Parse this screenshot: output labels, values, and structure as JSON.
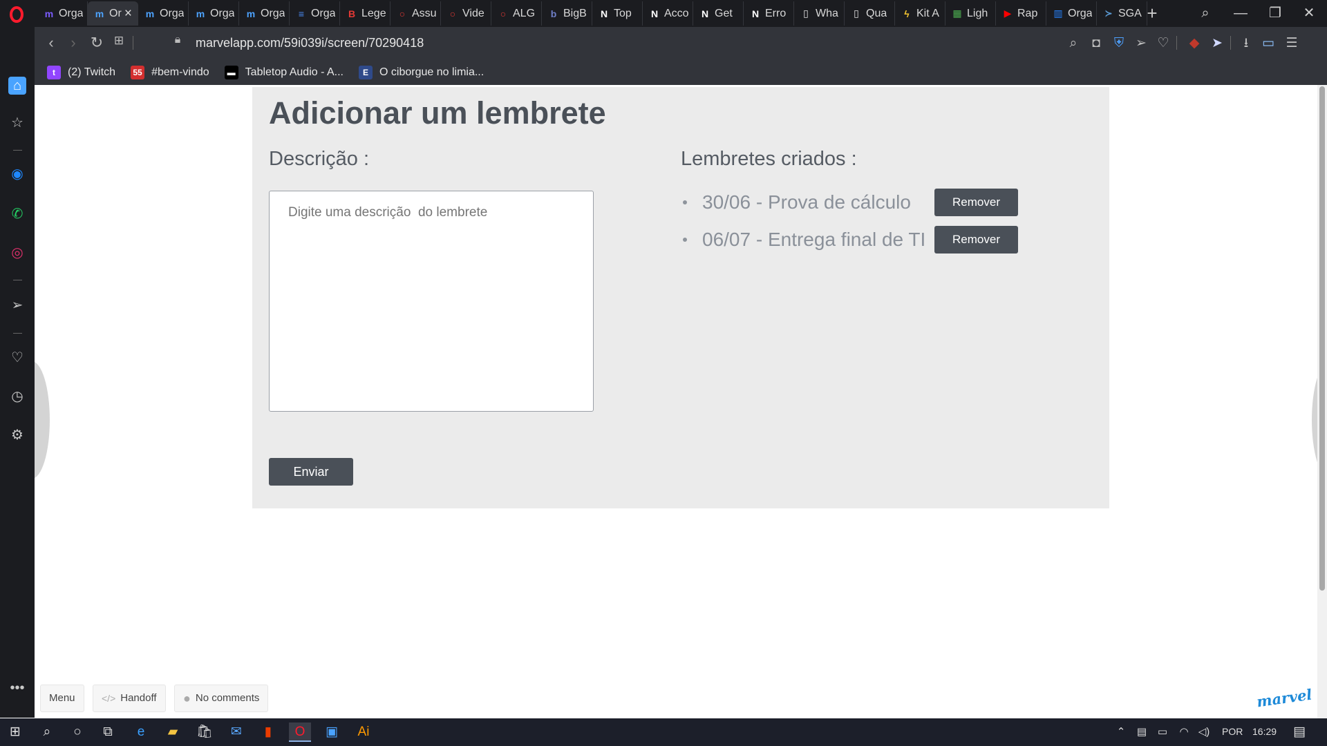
{
  "browser": {
    "tabs": [
      {
        "label": "Orga",
        "icon": "marvel-icon",
        "color": "#7b5cff",
        "glyph": "m"
      },
      {
        "label": "Or",
        "icon": "marvel-icon",
        "color": "#4da3ff",
        "glyph": "m",
        "active": true
      },
      {
        "label": "Orga",
        "icon": "marvel-icon",
        "color": "#4da3ff",
        "glyph": "m"
      },
      {
        "label": "Orga",
        "icon": "marvel-icon",
        "color": "#4da3ff",
        "glyph": "m"
      },
      {
        "label": "Orga",
        "icon": "marvel-icon",
        "color": "#4da3ff",
        "glyph": "m"
      },
      {
        "label": "Orga",
        "icon": "docs-icon",
        "color": "#4a8af4",
        "glyph": "≡"
      },
      {
        "label": "Lege",
        "icon": "b-icon",
        "color": "#e53935",
        "glyph": "B"
      },
      {
        "label": "Assu",
        "icon": "opera-ring-icon",
        "color": "#e53935",
        "glyph": "○"
      },
      {
        "label": "Vide",
        "icon": "opera-ring-icon",
        "color": "#e53935",
        "glyph": "○"
      },
      {
        "label": "ALG",
        "icon": "opera-ring-icon",
        "color": "#e53935",
        "glyph": "○"
      },
      {
        "label": "BigB",
        "icon": "bigbrain-icon",
        "color": "#6f7fc8",
        "glyph": "b"
      },
      {
        "label": "Top",
        "icon": "notion-icon",
        "color": "#ffffff",
        "glyph": "N"
      },
      {
        "label": "Acco",
        "icon": "notion-icon",
        "color": "#ffffff",
        "glyph": "N"
      },
      {
        "label": "Get",
        "icon": "notion-icon",
        "color": "#ffffff",
        "glyph": "N"
      },
      {
        "label": "Erro",
        "icon": "notion-icon",
        "color": "#ffffff",
        "glyph": "N"
      },
      {
        "label": "Wha",
        "icon": "document-icon",
        "color": "#e0e0e0",
        "glyph": "▯"
      },
      {
        "label": "Qua",
        "icon": "document-icon",
        "color": "#e0e0e0",
        "glyph": "▯"
      },
      {
        "label": "Kit A",
        "icon": "bolt-icon",
        "color": "#f4c430",
        "glyph": "ϟ"
      },
      {
        "label": "Ligh",
        "icon": "grid-icon",
        "color": "#4caf50",
        "glyph": "▦"
      },
      {
        "label": "Rap",
        "icon": "youtube-icon",
        "color": "#ff0000",
        "glyph": "▶"
      },
      {
        "label": "Orga",
        "icon": "trello-icon",
        "color": "#2684ff",
        "glyph": "▥"
      },
      {
        "label": "SGA",
        "icon": "sga-icon",
        "color": "#5b9bd5",
        "glyph": "≻"
      }
    ],
    "address": "marvelapp.com/59i039i/screen/70290418",
    "bookmarks": [
      {
        "label": "(2) Twitch",
        "icon": "twitch-icon",
        "color": "#9146ff",
        "glyph": "t"
      },
      {
        "label": "#bem-vindo",
        "icon": "discord-server-icon",
        "color": "#d32f2f",
        "glyph": "55"
      },
      {
        "label": "Tabletop Audio - A...",
        "icon": "tabletop-audio-icon",
        "color": "#000000",
        "glyph": "▬"
      },
      {
        "label": "O ciborgue no limia...",
        "icon": "e-icon",
        "color": "#2f4a8a",
        "glyph": "E"
      }
    ]
  },
  "prototype": {
    "title": "Adicionar um lembrete",
    "description_label": "Descrição :",
    "description_placeholder": "Digite uma descrição  do lembrete",
    "send_label": "Enviar",
    "reminders_label": "Lembretes criados :",
    "reminders": [
      {
        "text": "30/06 - Prova de cálculo",
        "remove_label": "Remover"
      },
      {
        "text": "06/07 - Entrega final de TI",
        "remove_label": "Remover"
      }
    ]
  },
  "marvel_footer": {
    "menu_label": "Menu",
    "handoff_label": "Handoff",
    "comments_label": "No comments",
    "logo_text": "marvel"
  },
  "taskbar": {
    "language": "POR",
    "time": "16:29"
  },
  "colors": {
    "card_bg": "#ebebeb",
    "button_bg": "#4a5058",
    "accent_marvel": "#1e8ad8"
  }
}
